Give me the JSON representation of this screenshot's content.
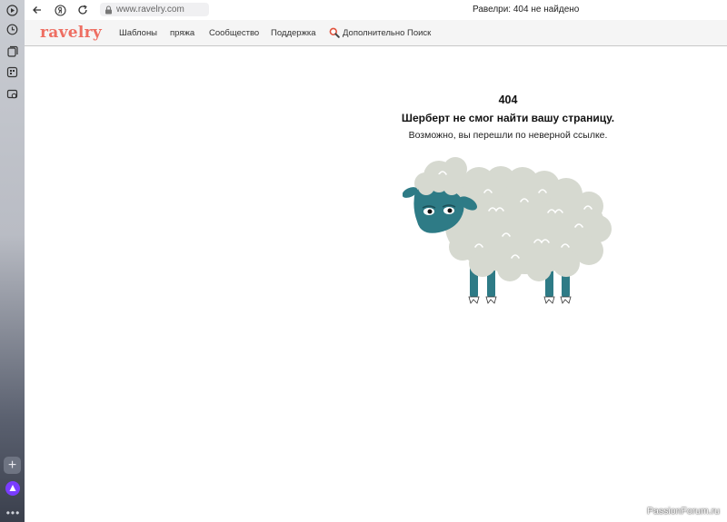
{
  "browser": {
    "url": "www.ravelry.com",
    "tab_title": "Равелри: 404 не найдено",
    "sidebar_icons": [
      "play-icon",
      "history-icon",
      "collections-icon",
      "tabs-icon",
      "screenshot-icon"
    ]
  },
  "site": {
    "logo": "ravelry",
    "nav": {
      "patterns": "Шаблоны",
      "yarn": "пряжа",
      "community": "Сообщество",
      "support": "Поддержка",
      "advanced_search": "Дополнительно Поиск"
    }
  },
  "error": {
    "code": "404",
    "title": "Шерберт не смог найти вашу страницу.",
    "subtitle": "Возможно, вы перешли по неверной ссылке."
  },
  "watermark": "PassionForum.ru",
  "colors": {
    "logo": "#ee6e62",
    "sheep_wool": "#d6d9d0",
    "sheep_face": "#2e7b86"
  }
}
